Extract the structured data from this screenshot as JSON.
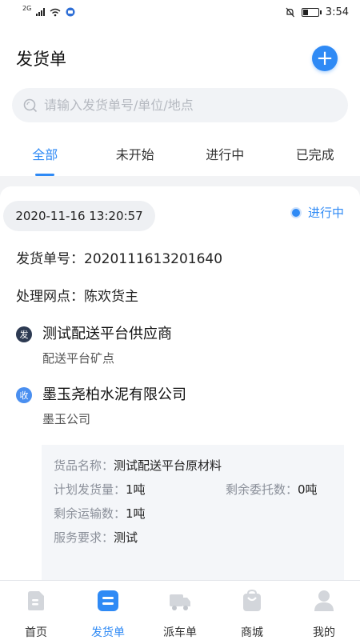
{
  "status_bar": {
    "network": "2G",
    "time": "3:54",
    "battery_level": 0.35
  },
  "header": {
    "title": "发货单",
    "add_symbol": "+"
  },
  "search": {
    "placeholder": "请输入发货单号/单位/地点"
  },
  "tabs": [
    {
      "label": "全部",
      "active": true
    },
    {
      "label": "未开始",
      "active": false
    },
    {
      "label": "进行中",
      "active": false
    },
    {
      "label": "已完成",
      "active": false
    }
  ],
  "order": {
    "datetime": "2020-11-16 13:20:57",
    "status": "进行中",
    "order_no": "发货单号：2020111613201640",
    "branch": "处理网点：陈欢货主",
    "sender": {
      "badge": "发",
      "name": "测试配送平台供应商",
      "location": "配送平台矿点"
    },
    "receiver": {
      "badge": "收",
      "name": "墨玉尧柏水泥有限公司",
      "location": "墨玉公司"
    },
    "details": {
      "goods_label": "货品名称：",
      "goods_value": "测试配送平台原材料",
      "planned_label": "计划发货量：",
      "planned_value": "1吨",
      "remaining_entrust_label": "剩余委托数：",
      "remaining_entrust_value": "0吨",
      "remaining_transport_label": "剩余运输数：",
      "remaining_transport_value": "1吨",
      "service_label": "服务要求：",
      "service_value": "测试"
    }
  },
  "tabbar": [
    {
      "label": "首页",
      "icon": "home-icon",
      "active": false
    },
    {
      "label": "发货单",
      "icon": "invoice-icon",
      "active": true
    },
    {
      "label": "派车单",
      "icon": "truck-icon",
      "active": false
    },
    {
      "label": "商城",
      "icon": "shop-bag-icon",
      "active": false
    },
    {
      "label": "我的",
      "icon": "user-icon",
      "active": false
    }
  ],
  "colors": {
    "accent": "#2f8af5",
    "inactive_icon": "#d3d6db",
    "sender_badge": "#2d3a52",
    "receiver_badge": "#4a8ff0"
  }
}
